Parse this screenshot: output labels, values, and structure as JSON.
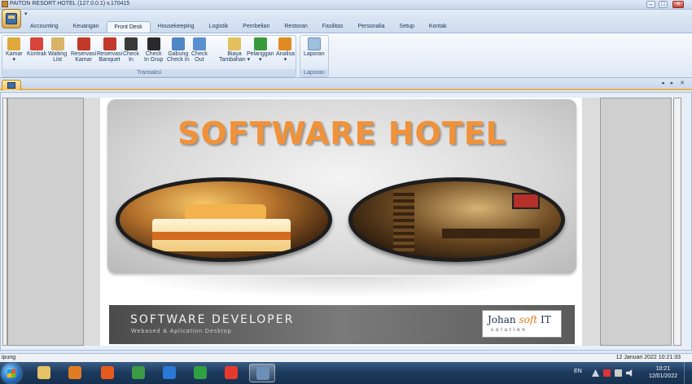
{
  "window": {
    "title": "PAITON RESORT HOTEL (127.0.0.1) v.170415",
    "minimize": "–",
    "maximize": "□",
    "close": "✕"
  },
  "qat": {
    "dropdown": "▾"
  },
  "tabs": [
    "Accounting",
    "Keuangan",
    "Front Desk",
    "Housekeeping",
    "Logistik",
    "Pembelian",
    "Restoran",
    "Fasilitas",
    "Personalia",
    "Setup",
    "Kontak"
  ],
  "active_tab": "Front Desk",
  "ribbon": {
    "transaksi": {
      "label": "Transaksi",
      "buttons": [
        {
          "l1": "Kamar",
          "l2": "▾",
          "icon": "box-icon",
          "color": "#e0a93c"
        },
        {
          "l1": "Kontrak",
          "l2": "",
          "icon": "pencil-document-icon",
          "color": "#d8443a"
        },
        {
          "l1": "Waiting",
          "l2": "List",
          "icon": "hourglass-icon",
          "color": "#d7b468"
        },
        {
          "l1": "Reservasi",
          "l2": "Kamar",
          "icon": "calendar-icon",
          "color": "#c0392b"
        },
        {
          "l1": "Reservasi",
          "l2": "Banquet",
          "icon": "calendar-icon",
          "color": "#c0392b"
        },
        {
          "l1": "Check",
          "l2": "In",
          "icon": "people-icon",
          "color": "#3a3a3a"
        },
        {
          "l1": "Check",
          "l2": "In Grup",
          "icon": "group-add-icon",
          "color": "#2a2a2a"
        },
        {
          "l1": "Gabung",
          "l2": "Check In",
          "icon": "merge-icon",
          "color": "#4f86c6"
        },
        {
          "l1": "Check",
          "l2": "Out",
          "icon": "checkout-icon",
          "color": "#5a8fd0"
        },
        {
          "l1": "Biaya",
          "l2": "Tambahan ▾",
          "icon": "coins-icon",
          "color": "#e2c15e"
        },
        {
          "l1": "Pelanggan",
          "l2": "▾",
          "icon": "add-customer-icon",
          "color": "#3a9a3a"
        },
        {
          "l1": "Analisa",
          "l2": "▾",
          "icon": "analysis-icon",
          "color": "#e08a24"
        }
      ]
    },
    "laporan": {
      "label": "Laporan",
      "buttons": [
        {
          "l1": "Laporan",
          "l2": "",
          "icon": "report-icon",
          "color": "#9fbfdf"
        }
      ]
    }
  },
  "docbar": {
    "controls": "◂ ▸ ✕"
  },
  "banner": {
    "title": "SOFTWARE HOTEL",
    "developer_title": "SOFTWARE DEVELOPER",
    "developer_subtitle": "Webased & Aplication Desktop",
    "logo_left": "Johan",
    "logo_mid": "soft",
    "logo_right": "IT",
    "logo_sub": "solution"
  },
  "status": {
    "left": "ipung",
    "right": "12 Januari 2022  10:21:33"
  },
  "taskbar": {
    "apps": [
      {
        "icon": "file-explorer-icon",
        "color": "#e6c364",
        "active": false
      },
      {
        "icon": "media-player-icon",
        "color": "#e07b24",
        "active": false
      },
      {
        "icon": "firefox-icon",
        "color": "#e55b1e",
        "active": false
      },
      {
        "icon": "chrome-icon",
        "color": "#3c9a48",
        "active": false
      },
      {
        "icon": "teamviewer-icon",
        "color": "#2b78d6",
        "active": false
      },
      {
        "icon": "green-triangle-app-icon",
        "color": "#2ea043",
        "active": false
      },
      {
        "icon": "anydesk-icon",
        "color": "#e63a2e",
        "active": false
      },
      {
        "icon": "hotel-app-icon",
        "color": "#6c8fb8",
        "active": true
      }
    ],
    "lang": "EN",
    "time": "10:21",
    "date": "12/01/2022"
  }
}
